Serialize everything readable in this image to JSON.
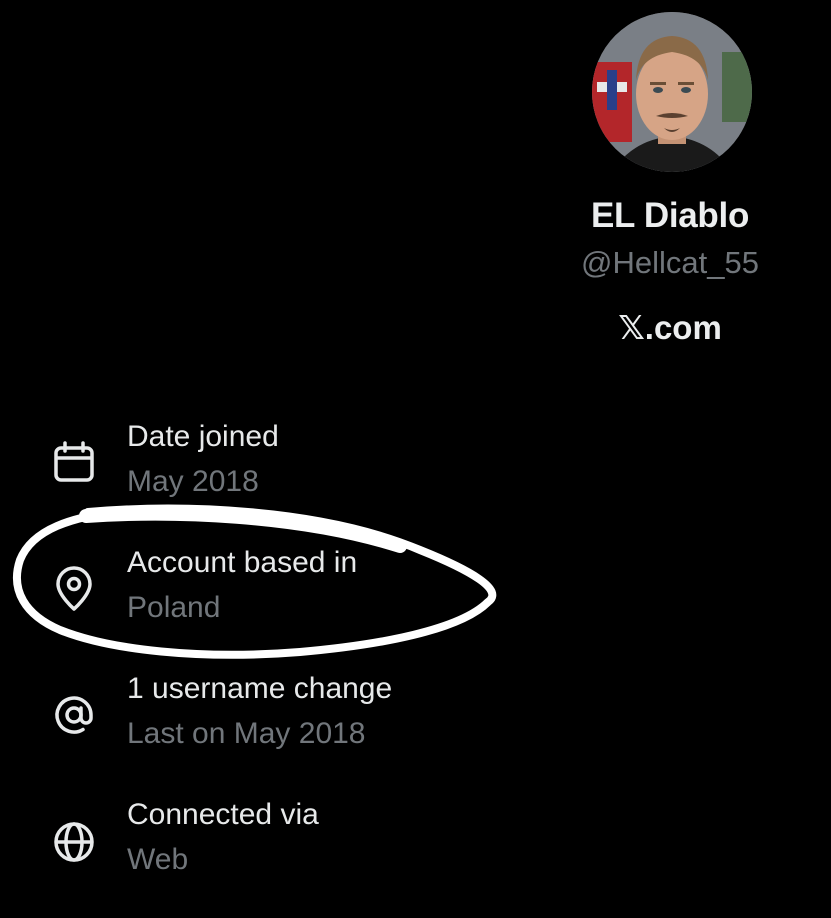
{
  "profile": {
    "display_name": "EL Diablo",
    "handle": "@Hellcat_55",
    "site": "𝕏.com"
  },
  "about": [
    {
      "icon": "calendar-icon",
      "label": "Date joined",
      "value": "May 2018"
    },
    {
      "icon": "location-pin-icon",
      "label": "Account based in",
      "value": "Poland"
    },
    {
      "icon": "at-sign-icon",
      "label": "1 username change",
      "value": "Last on May 2018"
    },
    {
      "icon": "globe-icon",
      "label": "Connected via",
      "value": "Web"
    }
  ],
  "colors": {
    "background": "#000000",
    "primary_text": "#e7e9ea",
    "secondary_text": "#71767b",
    "annotation": "#ffffff"
  }
}
